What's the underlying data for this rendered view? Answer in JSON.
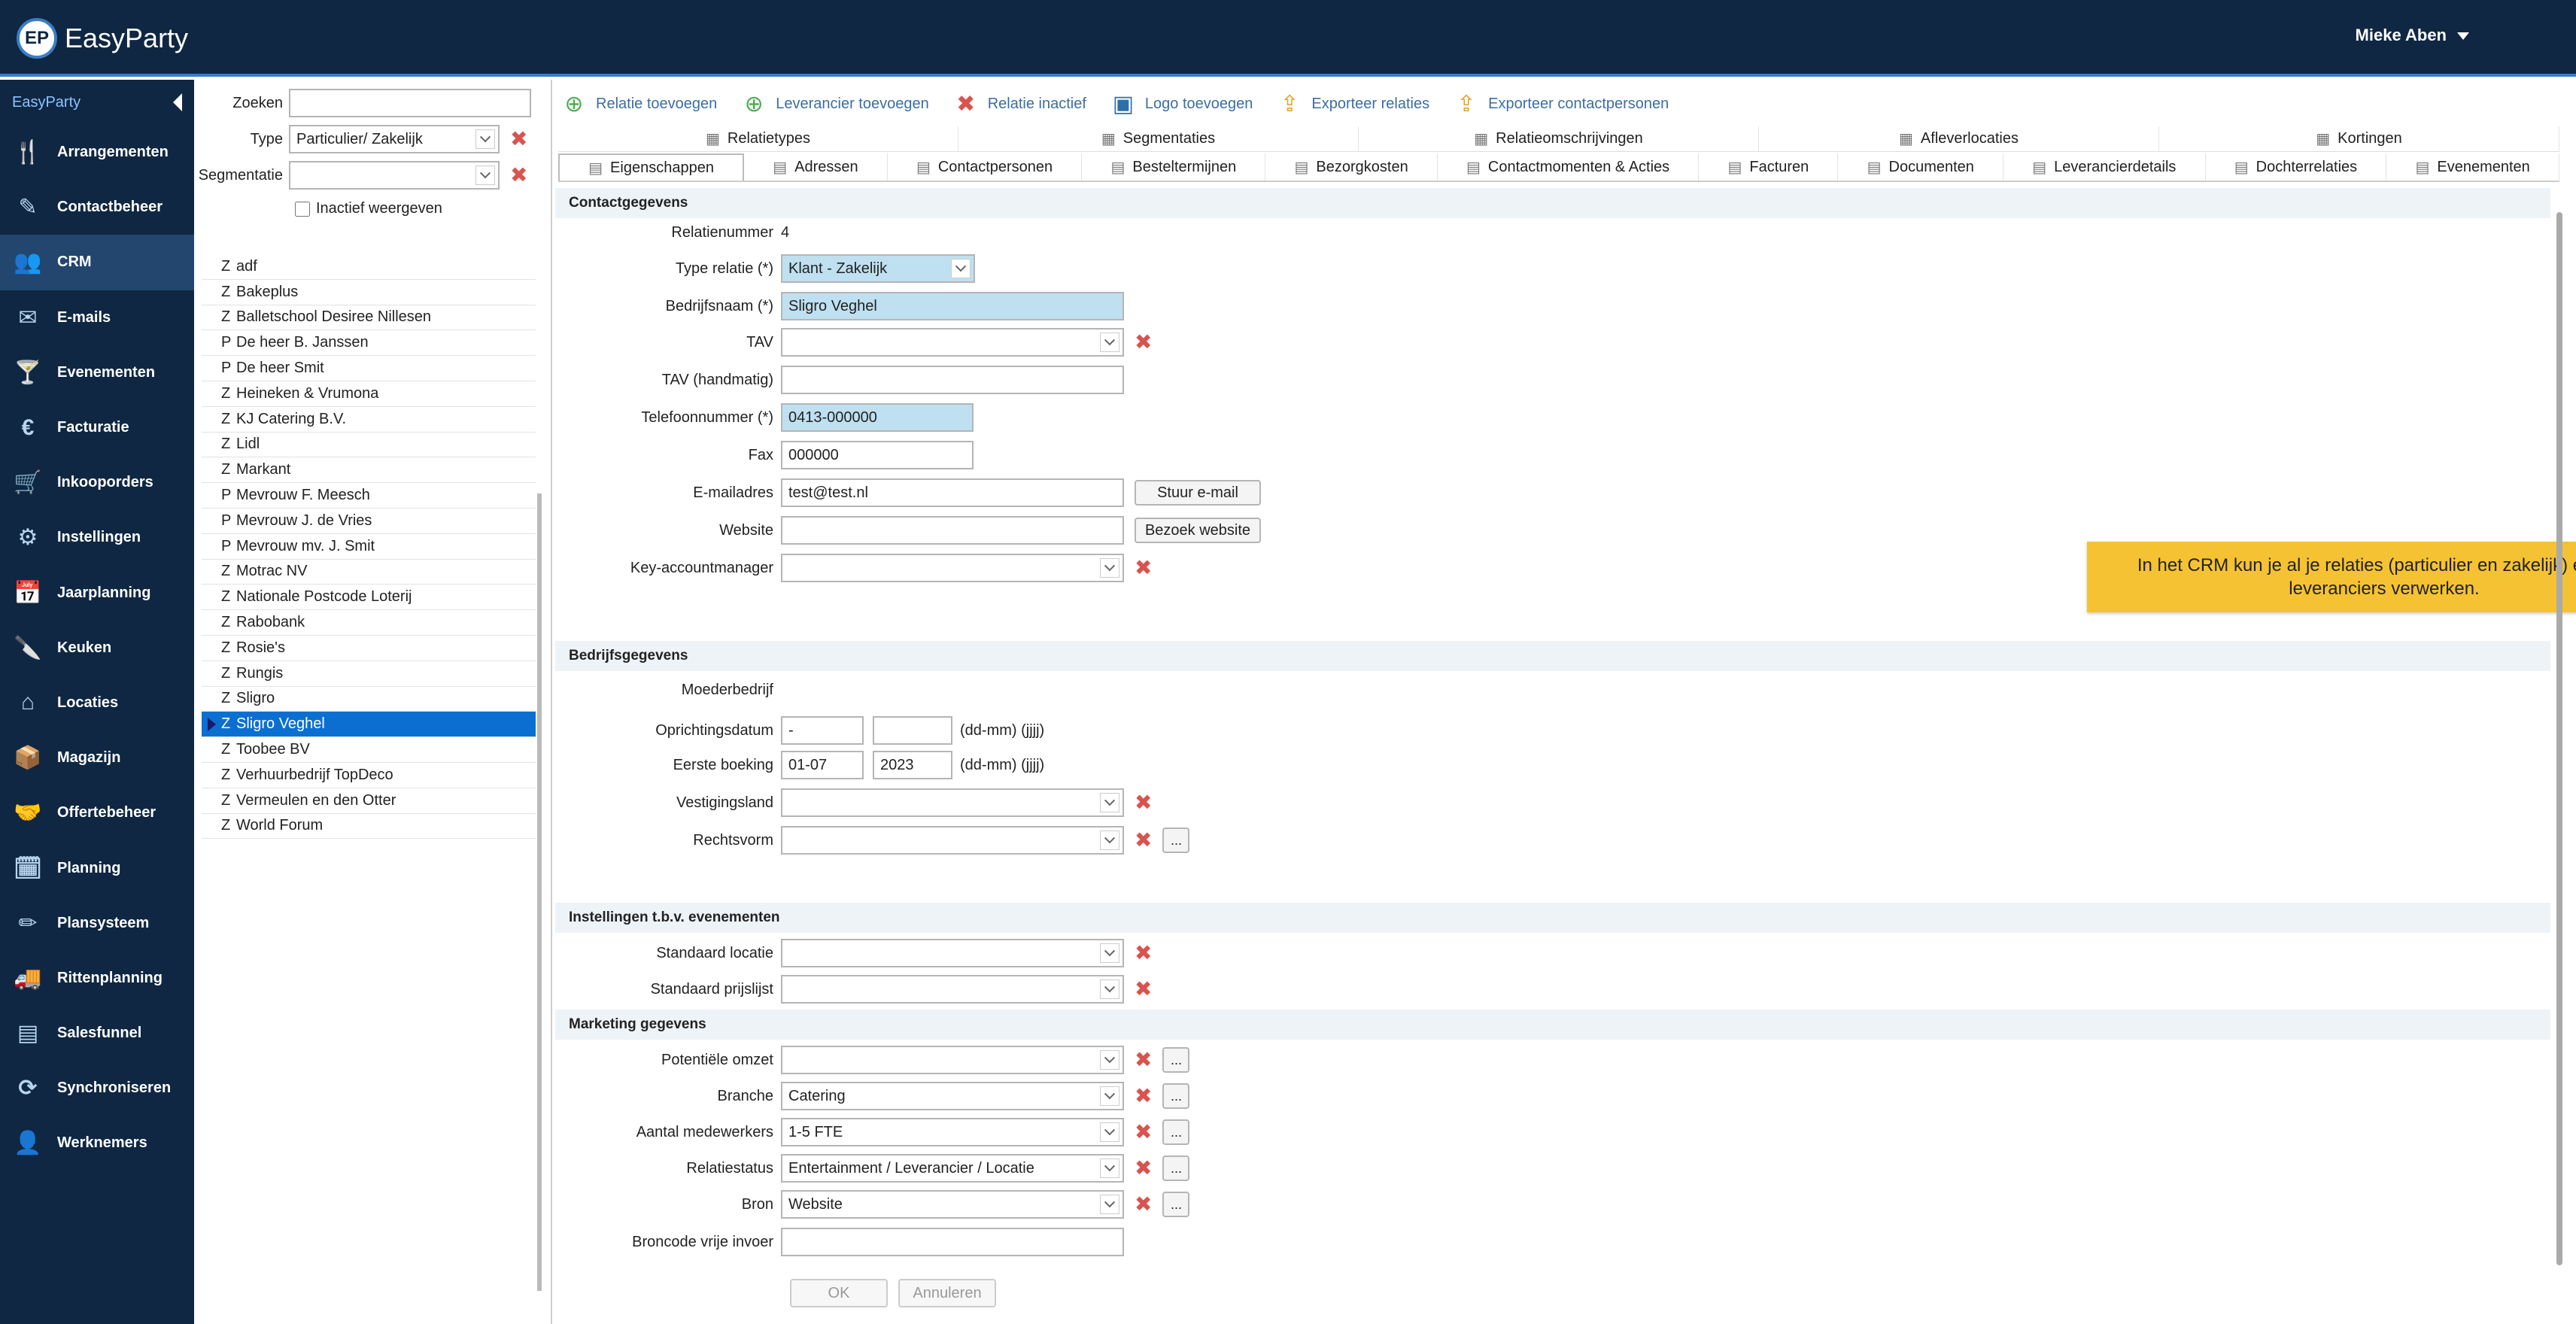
{
  "app": {
    "logo_mark": "EP",
    "logo_name": "EasyParty"
  },
  "user": {
    "name": "Mieke Aben"
  },
  "sidebar": {
    "header": "EasyParty",
    "items": [
      {
        "label": "Arrangementen",
        "icon": "🍴",
        "icon_name": "cutlery-icon"
      },
      {
        "label": "Contactbeheer",
        "icon": "✎",
        "icon_name": "edit-card-icon"
      },
      {
        "label": "CRM",
        "icon": "👥",
        "icon_name": "people-icon",
        "active": true
      },
      {
        "label": "E-mails",
        "icon": "✉",
        "icon_name": "envelope-icon"
      },
      {
        "label": "Evenementen",
        "icon": "🍸",
        "icon_name": "cocktail-icon"
      },
      {
        "label": "Facturatie",
        "icon": "€",
        "icon_name": "invoice-icon"
      },
      {
        "label": "Inkooporders",
        "icon": "🛒",
        "icon_name": "cart-icon"
      },
      {
        "label": "Instellingen",
        "icon": "⚙",
        "icon_name": "gear-icon"
      },
      {
        "label": "Jaarplanning",
        "icon": "📅",
        "icon_name": "calendar-icon"
      },
      {
        "label": "Keuken",
        "icon": "🔪",
        "icon_name": "knife-icon"
      },
      {
        "label": "Locaties",
        "icon": "⌂",
        "icon_name": "buildings-icon"
      },
      {
        "label": "Magazijn",
        "icon": "📦",
        "icon_name": "box-icon"
      },
      {
        "label": "Offertebeheer",
        "icon": "🤝",
        "icon_name": "handshake-icon"
      },
      {
        "label": "Planning",
        "icon": "🗓",
        "icon_name": "planning-icon"
      },
      {
        "label": "Plansysteem",
        "icon": "✏",
        "icon_name": "pencil-icon"
      },
      {
        "label": "Rittenplanning",
        "icon": "🚚",
        "icon_name": "truck-icon"
      },
      {
        "label": "Salesfunnel",
        "icon": "▤",
        "icon_name": "funnel-icon"
      },
      {
        "label": "Synchroniseren",
        "icon": "⟳",
        "icon_name": "sync-icon"
      },
      {
        "label": "Werknemers",
        "icon": "👤",
        "icon_name": "person-icon"
      }
    ]
  },
  "filter": {
    "search_label": "Zoeken",
    "search_value": "",
    "type_label": "Type",
    "type_value": "Particulier/ Zakelijk",
    "segment_label": "Segmentatie",
    "segment_value": "",
    "inactive_label": "Inactief weergeven"
  },
  "relations": [
    {
      "t": "Z",
      "n": "adf"
    },
    {
      "t": "Z",
      "n": "Bakeplus"
    },
    {
      "t": "Z",
      "n": "Balletschool Desiree Nillesen"
    },
    {
      "t": "P",
      "n": "De heer B. Janssen"
    },
    {
      "t": "P",
      "n": "De heer Smit"
    },
    {
      "t": "Z",
      "n": "Heineken & Vrumona"
    },
    {
      "t": "Z",
      "n": "KJ Catering B.V."
    },
    {
      "t": "Z",
      "n": "Lidl"
    },
    {
      "t": "Z",
      "n": "Markant"
    },
    {
      "t": "P",
      "n": "Mevrouw F. Meesch"
    },
    {
      "t": "P",
      "n": "Mevrouw J. de Vries"
    },
    {
      "t": "P",
      "n": "Mevrouw mv. J. Smit"
    },
    {
      "t": "Z",
      "n": "Motrac NV"
    },
    {
      "t": "Z",
      "n": "Nationale Postcode Loterij"
    },
    {
      "t": "Z",
      "n": "Rabobank"
    },
    {
      "t": "Z",
      "n": "Rosie's"
    },
    {
      "t": "Z",
      "n": "Rungis"
    },
    {
      "t": "Z",
      "n": "Sligro"
    },
    {
      "t": "Z",
      "n": "Sligro Veghel",
      "selected": true
    },
    {
      "t": "Z",
      "n": "Toobee BV"
    },
    {
      "t": "Z",
      "n": "Verhuurbedrijf TopDeco"
    },
    {
      "t": "Z",
      "n": "Vermeulen en den Otter"
    },
    {
      "t": "Z",
      "n": "World Forum"
    }
  ],
  "toolbar": [
    {
      "label": "Relatie toevoegen",
      "icon": "⊕",
      "color": "#4caf50"
    },
    {
      "label": "Leverancier toevoegen",
      "icon": "⊕",
      "color": "#4caf50"
    },
    {
      "label": "Relatie inactief",
      "icon": "✖",
      "color": "#d9534f"
    },
    {
      "label": "Logo toevoegen",
      "icon": "▣",
      "color": "#2d6fa8"
    },
    {
      "label": "Exporteer relaties",
      "icon": "⇪",
      "color": "#e6a020"
    },
    {
      "label": "Exporteer contactpersonen",
      "icon": "⇪",
      "color": "#e6a020"
    }
  ],
  "tabs_row1": [
    "Relatietypes",
    "Segmentaties",
    "Relatieomschrijvingen",
    "Afleverlocaties",
    "Kortingen"
  ],
  "tabs_row2": [
    "Eigenschappen",
    "Adressen",
    "Contactpersonen",
    "Besteltermijnen",
    "Bezorgkosten",
    "Contactmomenten & Acties",
    "Facturen",
    "Documenten",
    "Leverancierdetails",
    "Dochterrelaties",
    "Evenementen"
  ],
  "sections": {
    "contact": "Contactgegevens",
    "company": "Bedrijfsgegevens",
    "events": "Instellingen t.b.v. evenementen",
    "marketing": "Marketing gegevens"
  },
  "fields": {
    "relatienummer": {
      "label": "Relatienummer",
      "value": "4"
    },
    "type_relatie": {
      "label": "Type relatie (*)",
      "value": "Klant - Zakelijk"
    },
    "bedrijfsnaam": {
      "label": "Bedrijfsnaam (*)",
      "value": "Sligro Veghel"
    },
    "tav": {
      "label": "TAV",
      "value": ""
    },
    "tav_hand": {
      "label": "TAV (handmatig)",
      "value": ""
    },
    "telefoon": {
      "label": "Telefoonnummer (*)",
      "value": "0413-000000"
    },
    "fax": {
      "label": "Fax",
      "value": "000000"
    },
    "email": {
      "label": "E-mailadres",
      "value": "test@test.nl",
      "button": "Stuur e-mail"
    },
    "website": {
      "label": "Website",
      "value": "",
      "button": "Bezoek website"
    },
    "kam": {
      "label": "Key-accountmanager",
      "value": ""
    },
    "moeder": {
      "label": "Moederbedrijf"
    },
    "oprichting": {
      "label": "Oprichtingsdatum",
      "dm": "-",
      "y": "",
      "hint": "(dd-mm) (jjjj)"
    },
    "eerste": {
      "label": "Eerste boeking",
      "dm": "01-07",
      "y": "2023",
      "hint": "(dd-mm) (jjjj)"
    },
    "vestiging": {
      "label": "Vestigingsland",
      "value": ""
    },
    "rechtsvorm": {
      "label": "Rechtsvorm",
      "value": ""
    },
    "std_locatie": {
      "label": "Standaard locatie",
      "value": ""
    },
    "std_prijslijst": {
      "label": "Standaard prijslijst",
      "value": ""
    },
    "omzet": {
      "label": "Potentiële omzet",
      "value": ""
    },
    "branche": {
      "label": "Branche",
      "value": "Catering"
    },
    "medewerkers": {
      "label": "Aantal medewerkers",
      "value": "1-5 FTE"
    },
    "status": {
      "label": "Relatiestatus",
      "value": "Entertainment / Leverancier / Locatie"
    },
    "bron": {
      "label": "Bron",
      "value": "Website"
    },
    "broncode": {
      "label": "Broncode vrije invoer",
      "value": ""
    }
  },
  "dots_label": "...",
  "note": "In het CRM kun je al je relaties (particulier en zakelijk) en al je leveranciers verwerken.",
  "buttons": {
    "ok": "OK",
    "cancel": "Annuleren"
  }
}
